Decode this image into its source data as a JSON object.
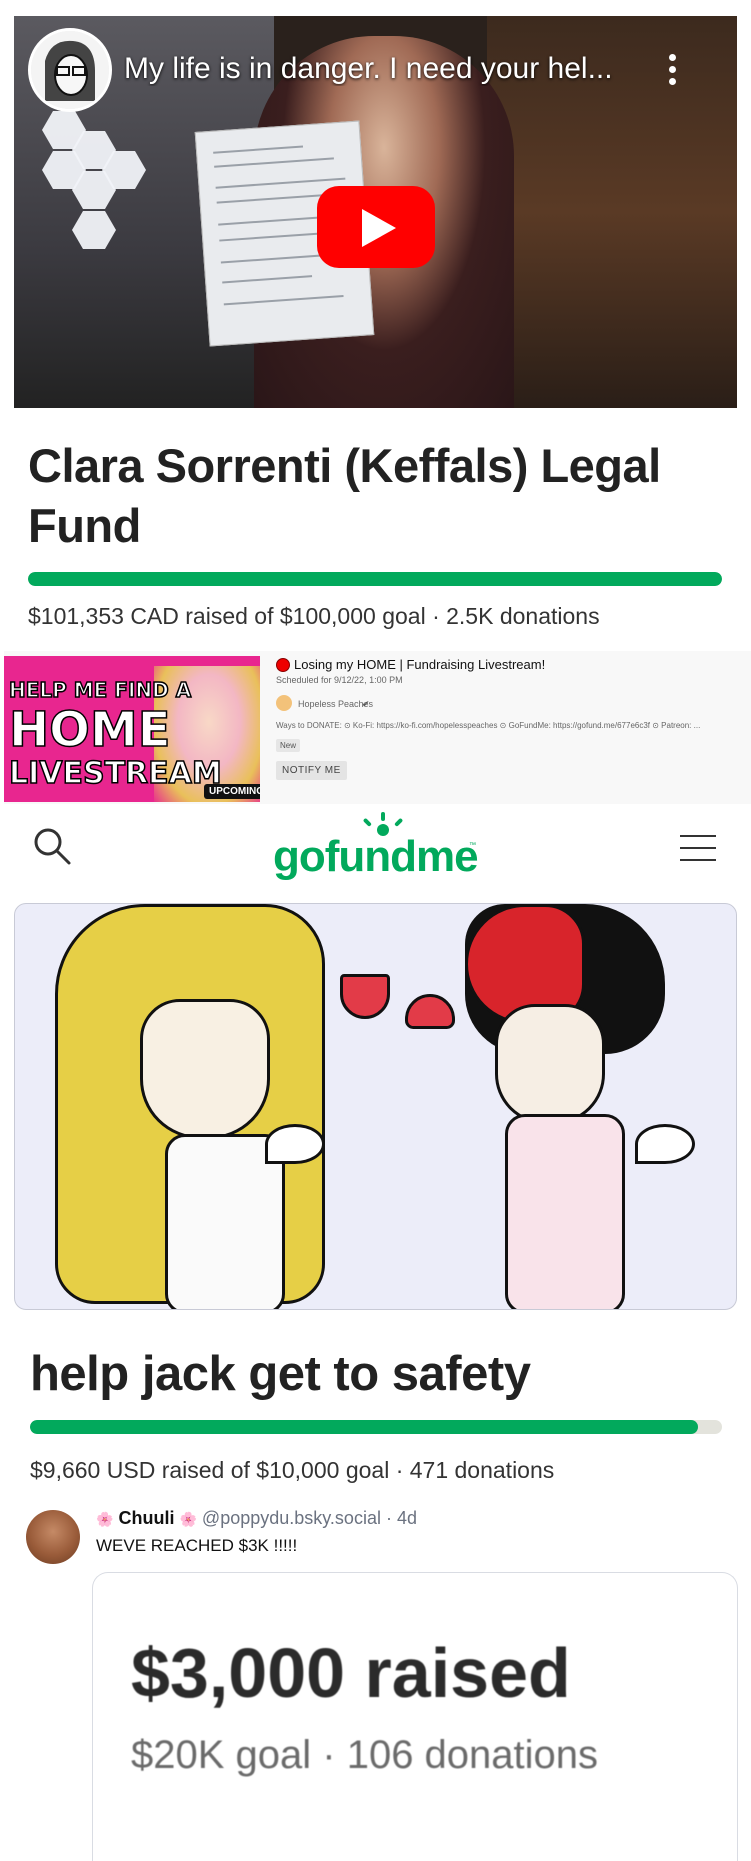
{
  "video": {
    "title": "My life is in danger. I need your hel...",
    "play_label": "",
    "accent": "#ff0000"
  },
  "fund1": {
    "title": "Clara Sorrenti (Keffals) Legal Fund",
    "stats": "$101,353 CAD raised of $100,000 goal · 2.5K donations",
    "progress_percent": 100
  },
  "livestream": {
    "thumb_line1": "HELP ME FIND A",
    "thumb_line2": "HOME",
    "thumb_line3": "LIVESTREAM",
    "badge": "UPCOMING",
    "title": "Losing my HOME | Fundraising Livestream!",
    "scheduled": "Scheduled for 9/12/22, 1:00 PM",
    "channel": "Hopeless Peaches",
    "description": "Ways to DONATE: ⊙ Ko-Fi: https://ko-fi.com/hopelesspeaches ⊙ GoFundMe: https://gofund.me/677e6c3f ⊙ Patreon: ...",
    "new_badge": "New",
    "notify_button": "NOTIFY ME"
  },
  "gofundme": {
    "logo": "gofundme",
    "tm": "™",
    "brand_color": "#02a95c"
  },
  "fund2": {
    "title": "help jack get to safety",
    "stats": "$9,660 USD raised of $10,000 goal · 471 donations",
    "progress_percent": 96.6
  },
  "post": {
    "name": "Chuuli",
    "handle": "@poppydu.bsky.social · 4d",
    "text": "WEVE REACHED $3K !!!!!",
    "card_amount": "$3,000 raised",
    "card_sub": "$20K goal  ·  106 donations"
  }
}
